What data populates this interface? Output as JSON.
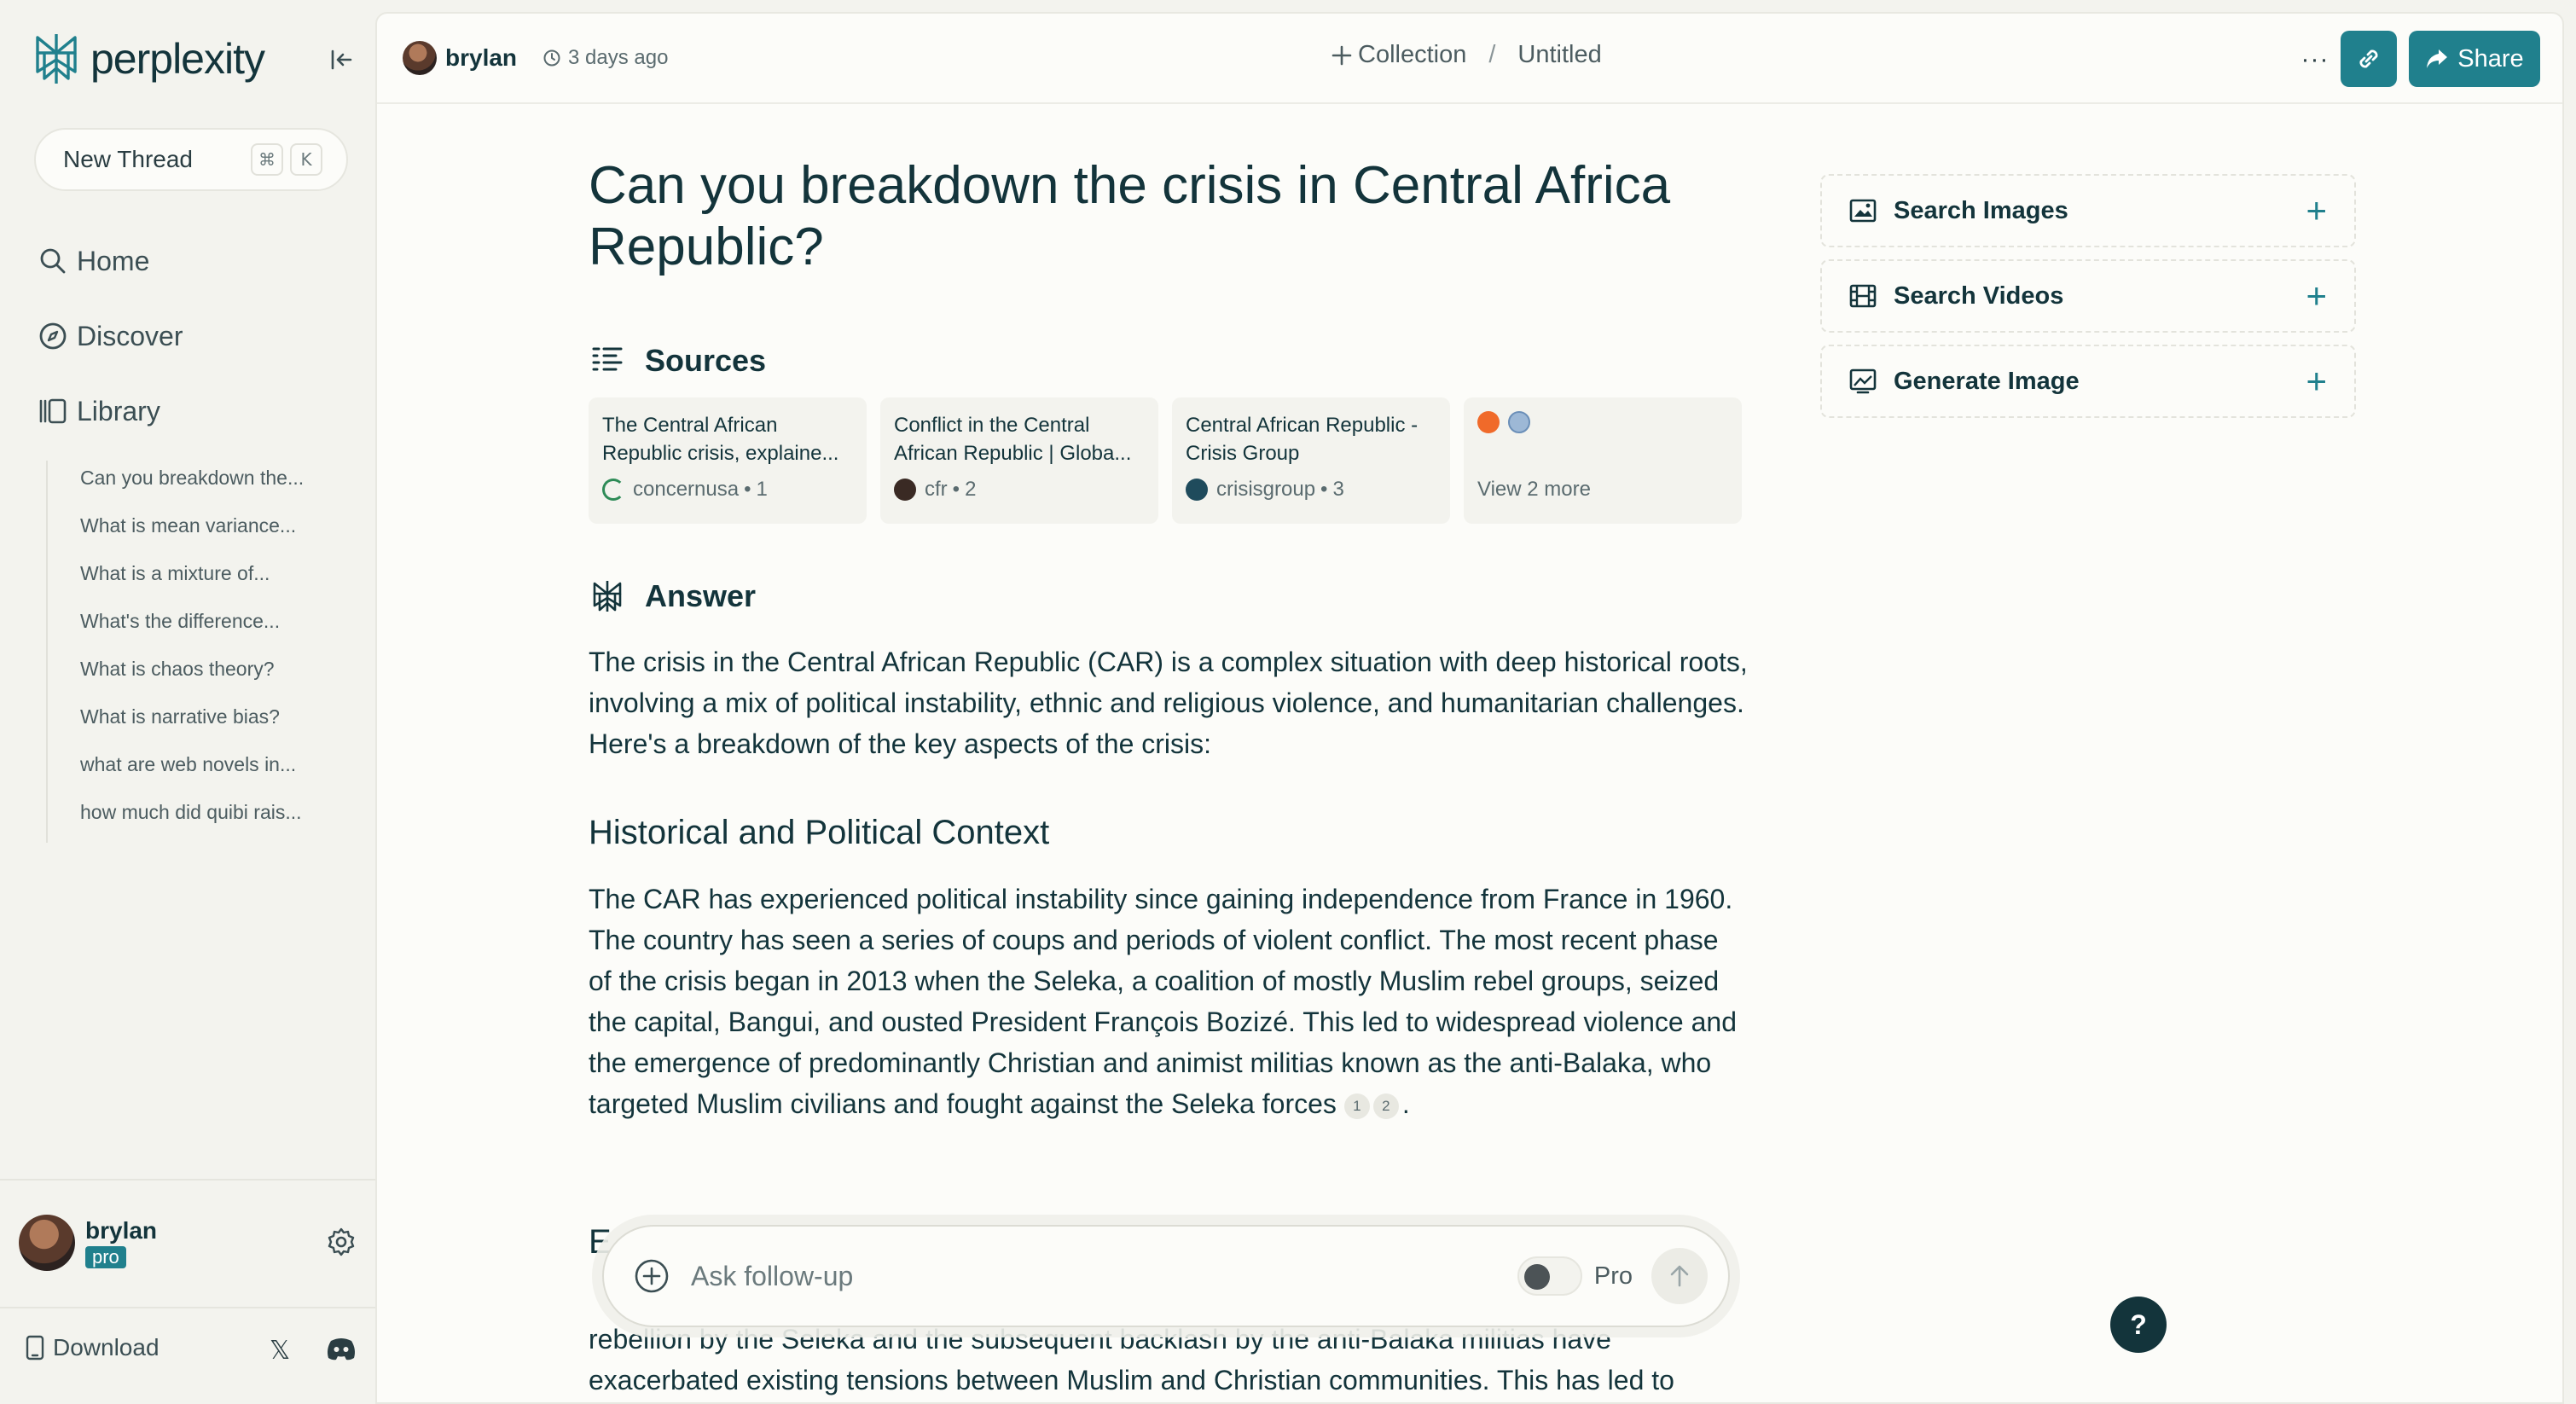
{
  "app": {
    "brand": "perplexity"
  },
  "sidebar": {
    "new_thread": {
      "label": "New Thread",
      "shortcut_keys": [
        "⌘",
        "K"
      ]
    },
    "nav": [
      {
        "label": "Home",
        "icon": "search-icon"
      },
      {
        "label": "Discover",
        "icon": "compass-icon"
      },
      {
        "label": "Library",
        "icon": "library-icon"
      }
    ],
    "history": [
      "Can you breakdown the...",
      "What is mean variance...",
      "What is a mixture of...",
      "What's the difference...",
      "What is chaos theory?",
      "What is narrative bias?",
      "what are web novels in...",
      "how much did quibi rais..."
    ],
    "user": {
      "name": "brylan",
      "badge": "pro"
    },
    "download_label": "Download"
  },
  "topbar": {
    "username": "brylan",
    "time": "3 days ago",
    "collection_label": "Collection",
    "separator": "/",
    "thread_title": "Untitled",
    "more": "···",
    "share_label": "Share"
  },
  "thread": {
    "question": "Can you breakdown the crisis in Central Africa Republic?",
    "sources_heading": "Sources",
    "sources": [
      {
        "title": "The Central African Republic crisis, explaine...",
        "site": "concernusa",
        "index": "1",
        "fav_color": "#2e8b57"
      },
      {
        "title": "Conflict in the Central African Republic | Globa...",
        "site": "cfr",
        "index": "2",
        "fav_color": "#3a2a24"
      },
      {
        "title": "Central African Republic - Crisis Group",
        "site": "crisisgroup",
        "index": "3",
        "fav_color": "#1f4b5c"
      }
    ],
    "view_more": "View 2 more",
    "answer_heading": "Answer",
    "intro": "The crisis in the Central African Republic (CAR) is a complex situation with deep historical roots, involving a mix of political instability, ethnic and religious violence, and humanitarian challenges. Here's a breakdown of the key aspects of the crisis:",
    "section1_title": "Historical and Political Context",
    "section1_body": "The CAR has experienced political instability since gaining independence from France in 1960. The country has seen a series of coups and periods of violent conflict. The most recent phase of the crisis began in 2013 when the Seleka, a coalition of mostly Muslim rebel groups, seized the capital, Bangui, and ousted President François Bozizé. This led to widespread violence and the emergence of predominantly Christian and animist militias known as the anti-Balaka, who targeted Muslim civilians and fought against the Seleka forces",
    "section1_cites": [
      "1",
      "2"
    ],
    "section1_end": ".",
    "section2_partial_title": "E",
    "section2_partial_line": "rebellion by the Seleka and the subsequent backlash by the anti-Balaka militias have",
    "section2_partial_line2": "exacerbated existing tensions between Muslim and Christian communities. This has led to"
  },
  "right_panel": [
    {
      "label": "Search Images",
      "icon": "image-icon"
    },
    {
      "label": "Search Videos",
      "icon": "film-icon"
    },
    {
      "label": "Generate Image",
      "icon": "generate-image-icon"
    }
  ],
  "ask": {
    "placeholder": "Ask follow-up",
    "pro_label": "Pro"
  },
  "help": "?",
  "colors": {
    "accent": "#20808d",
    "text": "#13343b",
    "background": "#f3f3ee",
    "panel": "#fcfcf9"
  }
}
